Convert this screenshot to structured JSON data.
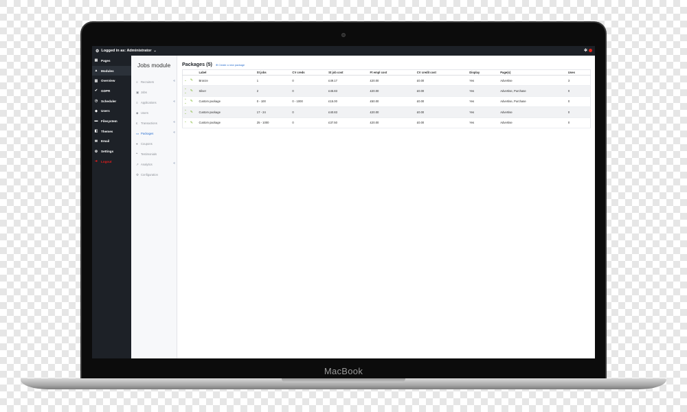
{
  "device": {
    "brand": "MacBook"
  },
  "topbar": {
    "logged_in_text": "Logged in as: Administrator"
  },
  "sidebar": {
    "items": [
      {
        "label": "Pages",
        "icon": "page-icon"
      },
      {
        "label": "Modules",
        "icon": "modules-icon",
        "active": true
      },
      {
        "label": "Overview",
        "icon": "chart-icon"
      },
      {
        "label": "GDPR",
        "icon": "check-circle-icon"
      },
      {
        "label": "Scheduler",
        "icon": "clock-icon"
      },
      {
        "label": "Users",
        "icon": "users-icon"
      },
      {
        "label": "Filesystem",
        "icon": "folder-icon"
      },
      {
        "label": "Themes",
        "icon": "themes-icon"
      },
      {
        "label": "Email",
        "icon": "envelope-icon"
      },
      {
        "label": "Settings",
        "icon": "gear-icon"
      },
      {
        "label": "Logout",
        "icon": "logout-icon"
      }
    ]
  },
  "subnav": {
    "title": "Jobs module",
    "items": [
      {
        "label": "Recruiters",
        "icon": "list-icon",
        "chevron": true
      },
      {
        "label": "Jobs",
        "icon": "briefcase-icon",
        "chevron": false
      },
      {
        "label": "Applications",
        "icon": "list-icon",
        "chevron": true
      },
      {
        "label": "Users",
        "icon": "users-icon",
        "chevron": false
      },
      {
        "label": "Transactions",
        "icon": "currency-icon",
        "chevron": true
      },
      {
        "label": "Packages",
        "icon": "package-icon",
        "chevron": true,
        "active": true
      },
      {
        "label": "Coupons",
        "icon": "tag-icon",
        "chevron": false
      },
      {
        "label": "Testimonials",
        "icon": "quote-icon",
        "chevron": false
      },
      {
        "label": "Analytics",
        "icon": "analytics-icon",
        "chevron": true
      },
      {
        "label": "Configuration",
        "icon": "gear-icon",
        "chevron": false
      }
    ]
  },
  "main": {
    "title": "Packages (5)",
    "create_link": "Create a new package",
    "columns": [
      "",
      "Label",
      "St jobs",
      "CV creds",
      "St job cost",
      "Ft empl cost",
      "CV credit cost",
      "Display",
      "Page(s)",
      "Uses"
    ],
    "rows": [
      [
        "Bronze",
        "1",
        "0",
        "£49.17",
        "£20.00",
        "£0.00",
        "Yes",
        "Advertise",
        "3"
      ],
      [
        "Silver",
        "2",
        "0",
        "£45.83",
        "£20.00",
        "£0.00",
        "Yes",
        "Advertise, Purchase",
        "0"
      ],
      [
        "Custom package",
        "0 - 100",
        "0 - 1000",
        "£15.00",
        "£50.00",
        "£0.00",
        "Yes",
        "Advertise, Purchase",
        "0"
      ],
      [
        "Custom package",
        "17 - 24",
        "0",
        "£40.83",
        "£20.00",
        "£0.00",
        "Yes",
        "Advertise",
        "0"
      ],
      [
        "Custom package",
        "25 - 1000",
        "0",
        "£37.50",
        "£20.00",
        "£0.00",
        "Yes",
        "Advertise",
        "0"
      ]
    ]
  },
  "colors": {
    "accent_blue": "#2a6fcf",
    "dark_nav": "#1d2127",
    "logout_red": "#e21d1d",
    "action_green": "#7bb62b"
  }
}
